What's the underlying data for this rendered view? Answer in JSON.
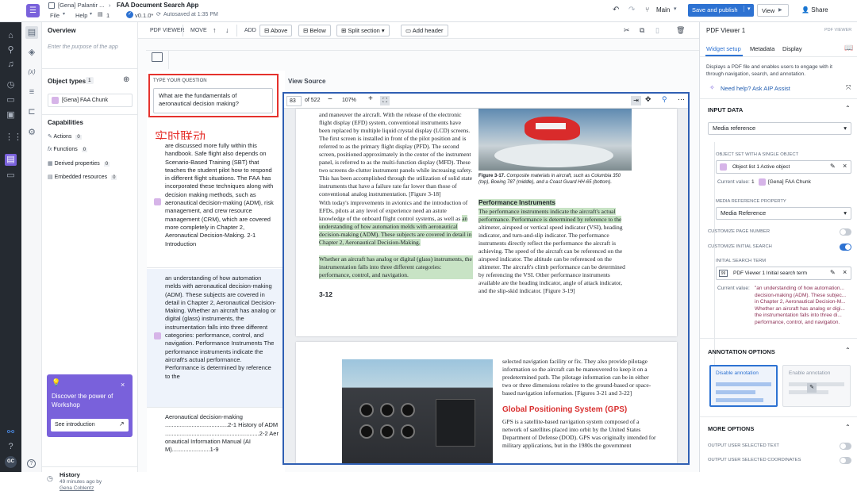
{
  "topbar": {
    "breadcrumb_parent": "[Gena] Palantir ...",
    "title": "FAA Document Search App",
    "menu_file": "File",
    "menu_help": "Help",
    "pages_count": "1",
    "version": "v0.1.0*",
    "autosave": "Autosaved at 1:35 PM",
    "branch": "Main",
    "save_publish": "Save and publish",
    "view": "View",
    "share": "Share"
  },
  "left_panel": {
    "overview_title": "Overview",
    "overview_placeholder": "Enter the purpose of the app",
    "object_types_title": "Object types",
    "object_types_count": "1",
    "object_type_item": "[Gena] FAA Chunk",
    "capabilities_title": "Capabilities",
    "capabilities": [
      {
        "label": "Actions",
        "count": "0"
      },
      {
        "label": "Functions",
        "count": "0"
      },
      {
        "label": "Derived properties",
        "count": "0"
      },
      {
        "label": "Embedded resources",
        "count": "0"
      }
    ],
    "promo_title": "Discover the power of Workshop",
    "promo_button": "See introduction",
    "history_title": "History",
    "history_time": "49 minutes ago by",
    "history_user": "Gena Coblentz"
  },
  "toolbar": {
    "section": "PDF VIEWER",
    "move": "MOVE",
    "add": "ADD",
    "above": "Above",
    "below": "Below",
    "split": "Split section",
    "add_header": "Add header"
  },
  "question": {
    "label": "TYPE YOUR QUESTION",
    "value": "What are the fundamentals of aeronautical decision making?",
    "annotation": "实时联动"
  },
  "results": [
    {
      "text": "are discussed more fully within this handbook. Safe flight also depends on Scenario-Based Training (SBT) that teaches the student pilot how to respond in different flight situations. The FAA has incorporated these techniques along with decision making methods, such as aeronautical decision-making (ADM), risk management, and crew resource management (CRM), which are covered more completely in Chapter 2, Aeronautical Decision-Making. 2-1 Introduction"
    },
    {
      "text": "an understanding of how automation melds with aeronautical decision-making (ADM). These subjects are covered in detail in Chapter 2, Aeronautical Decision-Making. Whether an aircraft has analog or digital (glass) instruments, the instrumentation falls into three different categories: performance, control, and navigation. Performance Instruments The performance instruments indicate the aircraft's actual performance. Performance is determined by reference to the"
    },
    {
      "text": "Aeronautical decision-making ......................................2-1 History of ADM .........................................................2-2 Aeronautical Information Manual (AIM).......................1-9"
    }
  ],
  "viewer": {
    "label": "View Source",
    "page": "83",
    "of_pages": "of 522",
    "zoom": "107%",
    "col1_p1": "and maneuver the aircraft. With the release of the electronic flight display (EFD) system, conventional instruments have been replaced by multiple liquid crystal display (LCD) screens. The first screen is installed in front of the pilot position and is referred to as the primary flight display (PFD). The second screen, positioned approximately in the center of the instrument panel, is referred to as the multi-function display (MFD). These two screens de-clutter instrument panels while increasing safety. This has been accomplished through the utilization of solid state instruments that have a failure rate far lower than those of conventional analog instrumentation. [Figure 3-18]",
    "col1_p2a": "With today's improvements in avionics and the introduction of EFDs, pilots at any level of experience need an astute knowledge of the onboard flight control systems, as well as ",
    "col1_p2b": "an understanding of how automation melds with aeronautical decision-making (ADM). These subjects are covered in detail in Chapter 2, Aeronautical Decision-Making.",
    "col1_p3": "Whether an aircraft has analog or digital (glass) instruments, the instrumentation falls into three different categories: performance, control, and navigation.",
    "page_no": "3-12",
    "fig_caption_bold": "Figure 3-17.",
    "fig_caption": " Composite materials in aircraft, such as Columbia 350 (top), Boeing 787 (middle), and a Coast Guard HH-65 (bottom).",
    "perf_heading": "Performance Instruments",
    "col2_hl": "The performance instruments indicate the aircraft's actual performance. Performance is determined by reference to the",
    "col2_rest": " altimeter, airspeed or vertical speed indicator (VSI), heading indicator, and turn-and-slip indicator. The performance instruments directly reflect the performance the aircraft is achieving. The speed of the aircraft can be referenced on the airspeed indicator. The altitude can be referenced on the altimeter. The aircraft's climb performance can be determined by referencing the VSI. Other performance instruments available are the heading indicator, angle of attack indicator, and the slip-skid indicator. [Figure 3-19]",
    "p2_text1": "selected navigation facility or fix. They also provide pilotage information so the aircraft can be maneuvered to keep it on a predetermined path. The pilotage information can be in either two or three dimensions relative to the ground-based or space-based navigation information. [Figures 3-21 and 3-22]",
    "gps_heading": "Global Positioning System (GPS)",
    "p2_text2": "GPS is a satellite-based navigation system composed of a network of satellites placed into orbit by the United States Department of Defense (DOD). GPS was originally intended for military applications, but in the 1980s the government"
  },
  "right_panel": {
    "title": "PDF Viewer 1",
    "tag": "PDF VIEWER",
    "tabs": [
      "Widget setup",
      "Metadata",
      "Display"
    ],
    "desc": "Displays a PDF file and enables users to engage with it through navigation, search, and annotation.",
    "help": "Need help? Ask AIP Assist",
    "input_data": "INPUT DATA",
    "media_ref": "Media reference",
    "obj_set_label": "OBJECT SET WITH A SINGLE OBJECT",
    "obj_set_value": "Object list 1 Active object",
    "current_value_label": "Current value:",
    "current_value": "1",
    "current_value_item": "[Gena] FAA Chunk",
    "media_prop_label": "MEDIA REFERENCE PROPERTY",
    "media_prop_value": "Media Reference",
    "customize_page": "CUSTOMIZE PAGE NUMBER",
    "customize_search": "CUSTOMIZE INITIAL SEARCH",
    "initial_term_label": "INITIAL SEARCH TERM",
    "initial_term_value": "PDF Viewer 1 Initial search term",
    "initial_current_label": "Current value:",
    "initial_current": "\"an understanding of how automation... decision-making (ADM). These subjec... in Chapter 2, Aeronautical Decision-M... Whether an aircraft has analog or digi... the instrumentation falls into three di... performance, control, and navigation. Performance Instruments",
    "annotation_options": "ANNOTATION OPTIONS",
    "disable_annotation": "Disable annotation",
    "enable_annotation": "Enable annotation",
    "more_options": "MORE OPTIONS",
    "output_text": "OUTPUT USER SELECTED TEXT",
    "output_coords": "OUTPUT USER SELECTED COORDINATES"
  },
  "colors": {
    "accent": "#2d72d2",
    "annotation_red": "#e5322d",
    "highlight": "#c8e3c5",
    "rail": "#252a31"
  }
}
